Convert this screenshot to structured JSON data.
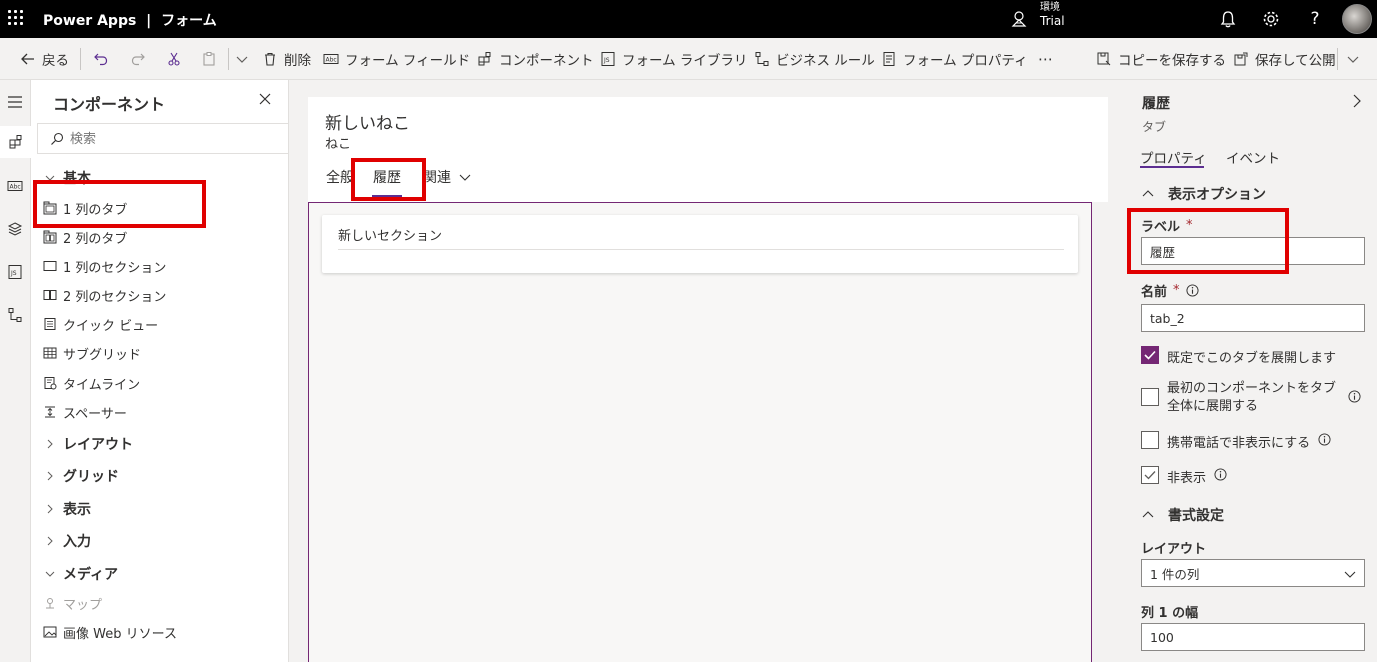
{
  "header": {
    "app_name": "Power Apps",
    "separator": "|",
    "page_name": "フォーム",
    "environment_label": "環境",
    "environment_value": "Trial"
  },
  "commands": {
    "back": "戻る",
    "delete": "削除",
    "form_fields": "フォーム フィールド",
    "components": "コンポーネント",
    "form_libraries": "フォーム ライブラリ",
    "business_rules": "ビジネス ルール",
    "form_properties": "フォーム プロパティ",
    "more": "⋯",
    "save_copy": "コピーを保存する",
    "save_publish": "保存して公開"
  },
  "components_panel": {
    "title": "コンポーネント",
    "search_placeholder": "検索",
    "groups": {
      "basic": "基本",
      "layout": "レイアウト",
      "grid": "グリッド",
      "display": "表示",
      "input": "入力",
      "media": "メディア"
    },
    "basic_items": [
      "1 列のタブ",
      "2 列のタブ",
      "1 列のセクション",
      "2 列のセクション",
      "クイック ビュー",
      "サブグリッド",
      "タイムライン",
      "スペーサー"
    ],
    "media_items": [
      "マップ",
      "画像 Web リソース"
    ]
  },
  "form": {
    "title": "新しいねこ",
    "entity": "ねこ",
    "tabs": [
      "全般",
      "履歴",
      "関連"
    ],
    "active_tab": "履歴",
    "section_title": "新しいセクション"
  },
  "properties": {
    "title": "履歴",
    "subtitle": "タブ",
    "tab_properties": "プロパティ",
    "tab_events": "イベント",
    "display_options": "表示オプション",
    "label_label": "ラベル",
    "required_mark": "*",
    "label_value": "履歴",
    "name_label": "名前",
    "name_value": "tab_2",
    "expand_default": "既定でこのタブを展開します",
    "expand_first_line1": "最初のコンポーネントをタブ",
    "expand_first_line2": "全体に展開する",
    "hide_phone": "携帯電話で非表示にする",
    "hidden": "非表示",
    "formatting": "書式設定",
    "layout_label": "レイアウト",
    "layout_value": "1 件の列",
    "col_width_label": "列 1 の幅",
    "col_width_value": "100"
  },
  "colors": {
    "accent": "#742774",
    "highlight": "#e00000"
  }
}
